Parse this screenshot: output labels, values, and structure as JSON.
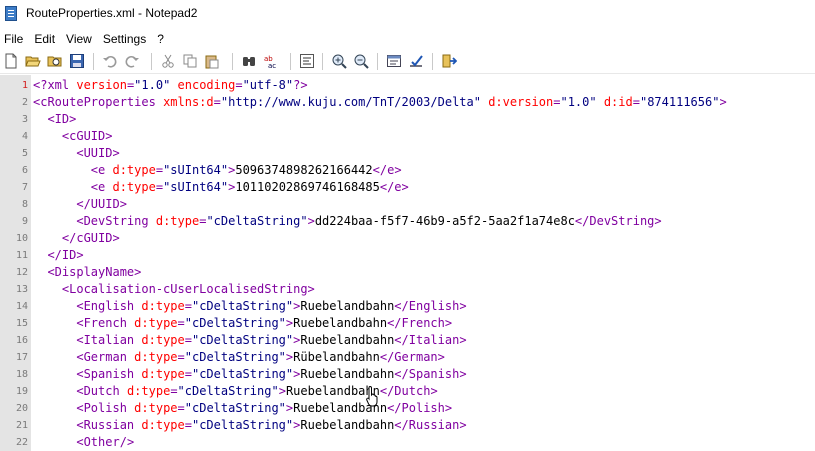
{
  "window": {
    "title": "RouteProperties.xml - Notepad2"
  },
  "menu": {
    "items": [
      "File",
      "Edit",
      "View",
      "Settings",
      "?"
    ]
  },
  "toolbar": {
    "icons": [
      "new-file-icon",
      "open-folder-icon",
      "browse-icon",
      "save-icon",
      "undo-icon",
      "redo-icon",
      "cut-icon",
      "copy-icon",
      "paste-icon",
      "find-icon",
      "replace-icon",
      "word-wrap-icon",
      "zoom-in-icon",
      "zoom-out-icon",
      "scheme-icon",
      "customize-icon",
      "exit-icon"
    ]
  },
  "editor": {
    "line_numbers": [
      "1",
      "2",
      "3",
      "4",
      "5",
      "6",
      "7",
      "8",
      "9",
      "10",
      "11",
      "12",
      "13",
      "14",
      "15",
      "16",
      "17",
      "18",
      "19",
      "20",
      "21",
      "22"
    ],
    "lines": [
      "<?xml version=\"1.0\" encoding=\"utf-8\"?>",
      "<cRouteProperties xmlns:d=\"http://www.kuju.com/TnT/2003/Delta\" d:version=\"1.0\" d:id=\"874111656\">",
      "  <ID>",
      "    <cGUID>",
      "      <UUID>",
      "        <e d:type=\"sUInt64\">5096374898262166442</e>",
      "        <e d:type=\"sUInt64\">10110202869746168485</e>",
      "      </UUID>",
      "      <DevString d:type=\"cDeltaString\">dd224baa-f5f7-46b9-a5f2-5aa2f1a74e8c</DevString>",
      "    </cGUID>",
      "  </ID>",
      "  <DisplayName>",
      "    <Localisation-cUserLocalisedString>",
      "      <English d:type=\"cDeltaString\">Ruebelandbahn</English>",
      "      <French d:type=\"cDeltaString\">Ruebelandbahn</French>",
      "      <Italian d:type=\"cDeltaString\">Ruebelandbahn</Italian>",
      "      <German d:type=\"cDeltaString\">Rübelandbahn</German>",
      "      <Spanish d:type=\"cDeltaString\">Ruebelandbahn</Spanish>",
      "      <Dutch d:type=\"cDeltaString\">Ruebelandbahn</Dutch>",
      "      <Polish d:type=\"cDeltaString\">Ruebelandbahn</Polish>",
      "      <Russian d:type=\"cDeltaString\">Ruebelandbahn</Russian>",
      "      <Other/>"
    ]
  },
  "colors": {
    "tag": "#8000a0",
    "attribute": "#ff0000",
    "string": "#000080",
    "gutter": "#e4e4e4",
    "first_line_number": "#d21f1f"
  }
}
